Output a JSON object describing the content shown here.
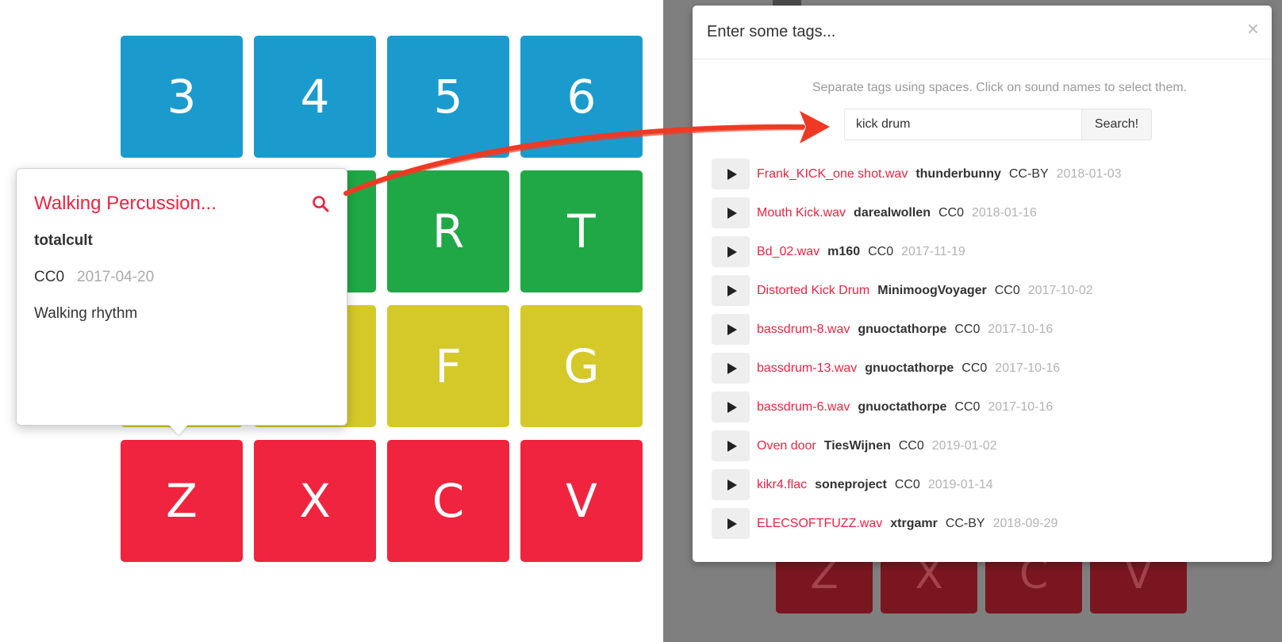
{
  "pad_grid": {
    "rows": [
      [
        {
          "label": "3",
          "color": "blue"
        },
        {
          "label": "4",
          "color": "blue"
        },
        {
          "label": "5",
          "color": "blue"
        },
        {
          "label": "6",
          "color": "blue"
        }
      ],
      [
        {
          "label": "",
          "color": "green"
        },
        {
          "label": "",
          "color": "green"
        },
        {
          "label": "R",
          "color": "green"
        },
        {
          "label": "T",
          "color": "green"
        }
      ],
      [
        {
          "label": "",
          "color": "yellow"
        },
        {
          "label": "",
          "color": "yellow"
        },
        {
          "label": "F",
          "color": "yellow"
        },
        {
          "label": "G",
          "color": "yellow"
        }
      ],
      [
        {
          "label": "Z",
          "color": "red"
        },
        {
          "label": "X",
          "color": "red"
        },
        {
          "label": "C",
          "color": "red"
        },
        {
          "label": "V",
          "color": "red"
        }
      ]
    ],
    "colors": {
      "blue": "#1b9bcd",
      "green": "#1fa845",
      "yellow": "#d5c92a",
      "red": "#f0243e"
    }
  },
  "popover": {
    "title": "Walking Percussion...",
    "search_icon": "search-icon",
    "author": "totalcult",
    "license": "CC0",
    "date": "2017-04-20",
    "description": "Walking rhythm",
    "accent": "#ee2340"
  },
  "background_pads": [
    "Z",
    "X",
    "C",
    "V"
  ],
  "modal": {
    "title": "Enter some tags...",
    "close_label": "×",
    "hint": "Separate tags using spaces. Click on sound names to select them.",
    "search_value": "kick drum",
    "search_button": "Search!",
    "results": [
      {
        "name": "Frank_KICK_one shot.wav",
        "user": "thunderbunny",
        "license": "CC-BY",
        "date": "2018-01-03"
      },
      {
        "name": "Mouth Kick.wav",
        "user": "darealwollen",
        "license": "CC0",
        "date": "2018-01-16"
      },
      {
        "name": "Bd_02.wav",
        "user": "m160",
        "license": "CC0",
        "date": "2017-11-19"
      },
      {
        "name": "Distorted Kick Drum",
        "user": "MinimoogVoyager",
        "license": "CC0",
        "date": "2017-10-02"
      },
      {
        "name": "bassdrum-8.wav",
        "user": "gnuoctathorpe",
        "license": "CC0",
        "date": "2017-10-16"
      },
      {
        "name": "bassdrum-13.wav",
        "user": "gnuoctathorpe",
        "license": "CC0",
        "date": "2017-10-16"
      },
      {
        "name": "bassdrum-6.wav",
        "user": "gnuoctathorpe",
        "license": "CC0",
        "date": "2017-10-16"
      },
      {
        "name": "Oven door",
        "user": "TiesWijnen",
        "license": "CC0",
        "date": "2019-01-02"
      },
      {
        "name": "kikr4.flac",
        "user": "soneproject",
        "license": "CC0",
        "date": "2019-01-14"
      },
      {
        "name": "ELECSOFTFUZZ.wav",
        "user": "xtrgamr",
        "license": "CC-BY",
        "date": "2018-09-29"
      }
    ]
  },
  "annotation": {
    "arrow_color": "#ee3a24"
  }
}
